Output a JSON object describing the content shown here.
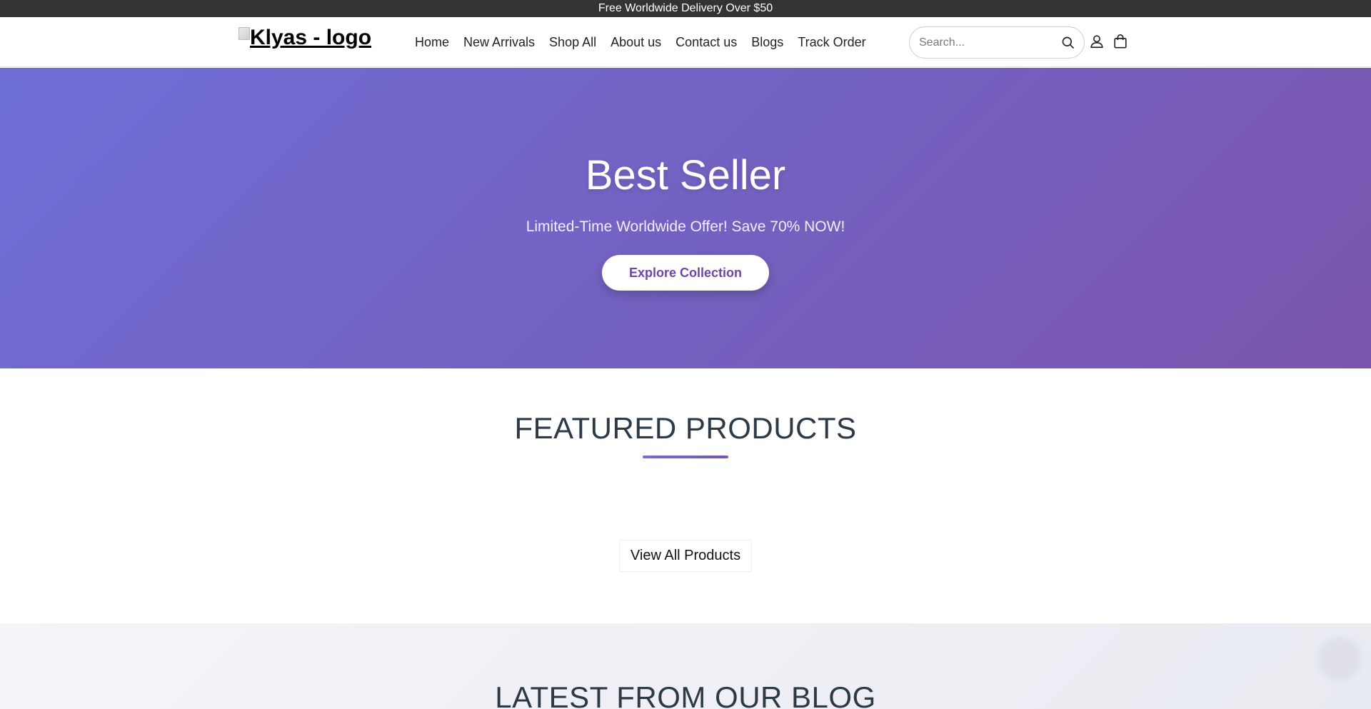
{
  "announcement": {
    "text": "Free Worldwide Delivery Over $50"
  },
  "header": {
    "logo_alt": "Klyas - logo",
    "nav": [
      "Home",
      "New Arrivals",
      "Shop All",
      "About us",
      "Contact us",
      "Blogs",
      "Track Order"
    ],
    "search": {
      "placeholder": "Search...",
      "value": ""
    },
    "icons": [
      "search-icon",
      "user-icon",
      "cart-icon"
    ]
  },
  "hero": {
    "title": "Best Seller",
    "subtitle": "Limited-Time Worldwide Offer! Save 70% NOW!",
    "cta": "Explore Collection"
  },
  "featured": {
    "title": "FEATURED PRODUCTS",
    "view_all": "View All Products"
  },
  "blog": {
    "title": "LATEST FROM OUR BLOG"
  },
  "colors": {
    "announcement_bg": "#333333",
    "hero_gradient_start": "#6f6ed6",
    "hero_gradient_end": "#7a55ad",
    "hero_button_text": "#6b46a8",
    "heading_text": "#2c3a48"
  }
}
